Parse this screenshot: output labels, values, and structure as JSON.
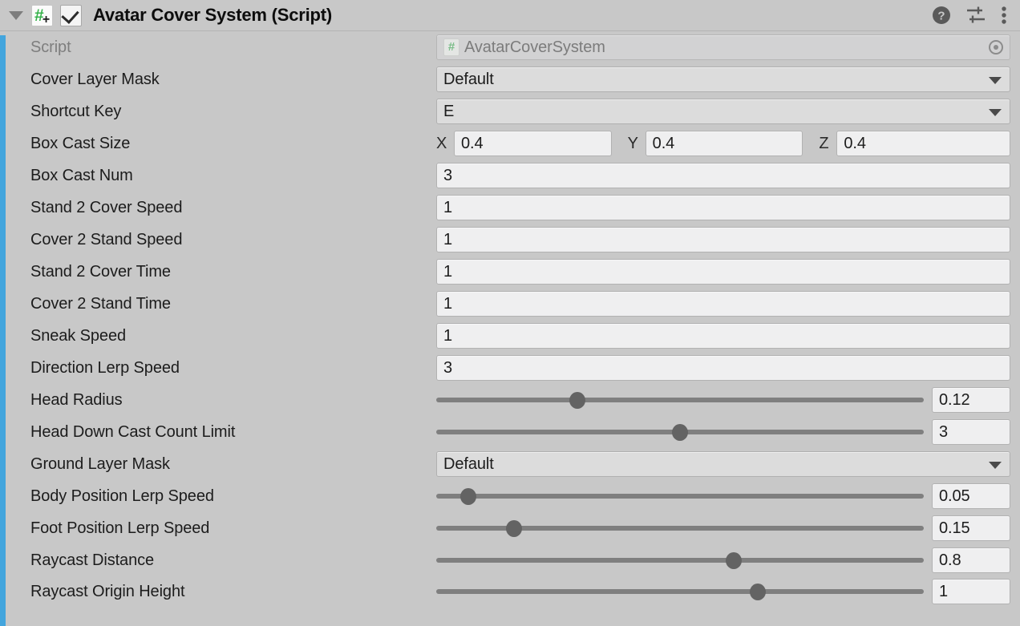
{
  "header": {
    "title": "Avatar Cover System (Script)",
    "foldout_expanded": true,
    "enabled": true,
    "script_icon_name": "csharp-script-icon",
    "icons": [
      {
        "name": "help-icon",
        "label": "?"
      },
      {
        "name": "preset-icon",
        "label": "Preset"
      },
      {
        "name": "more-menu-icon",
        "label": "More"
      }
    ],
    "accent_color": "#43a5dd"
  },
  "rows": [
    {
      "label": "Script",
      "type": "object",
      "value": "AvatarCoverSystem",
      "badge": "#",
      "disabled": true
    },
    {
      "label": "Cover Layer Mask",
      "type": "dropdown",
      "value": "Default"
    },
    {
      "label": "Shortcut Key",
      "type": "dropdown",
      "value": "E"
    },
    {
      "label": "Box Cast Size",
      "type": "vector3",
      "axes": [
        "X",
        "Y",
        "Z"
      ],
      "values": [
        "0.4",
        "0.4",
        "0.4"
      ]
    },
    {
      "label": "Box Cast Num",
      "type": "text",
      "value": "3"
    },
    {
      "label": "Stand 2 Cover Speed",
      "type": "text",
      "value": "1"
    },
    {
      "label": "Cover 2 Stand Speed",
      "type": "text",
      "value": "1"
    },
    {
      "label": "Stand 2 Cover Time",
      "type": "text",
      "value": "1"
    },
    {
      "label": "Cover 2 Stand Time",
      "type": "text",
      "value": "1"
    },
    {
      "label": "Sneak Speed",
      "type": "text",
      "value": "1"
    },
    {
      "label": "Direction Lerp Speed",
      "type": "text",
      "value": "3"
    },
    {
      "label": "Head Radius",
      "type": "slider",
      "value": "0.12",
      "fill_percent": 29
    },
    {
      "label": "Head Down Cast Count Limit",
      "type": "slider",
      "value": "3",
      "fill_percent": 50
    },
    {
      "label": "Ground Layer Mask",
      "type": "dropdown",
      "value": "Default"
    },
    {
      "label": "Body Position Lerp Speed",
      "type": "slider",
      "value": "0.05",
      "fill_percent": 6.5
    },
    {
      "label": "Foot Position Lerp Speed",
      "type": "slider",
      "value": "0.15",
      "fill_percent": 16
    },
    {
      "label": "Raycast Distance",
      "type": "slider",
      "value": "0.8",
      "fill_percent": 61
    },
    {
      "label": "Raycast Origin Height",
      "type": "slider",
      "value": "1",
      "fill_percent": 66
    }
  ]
}
